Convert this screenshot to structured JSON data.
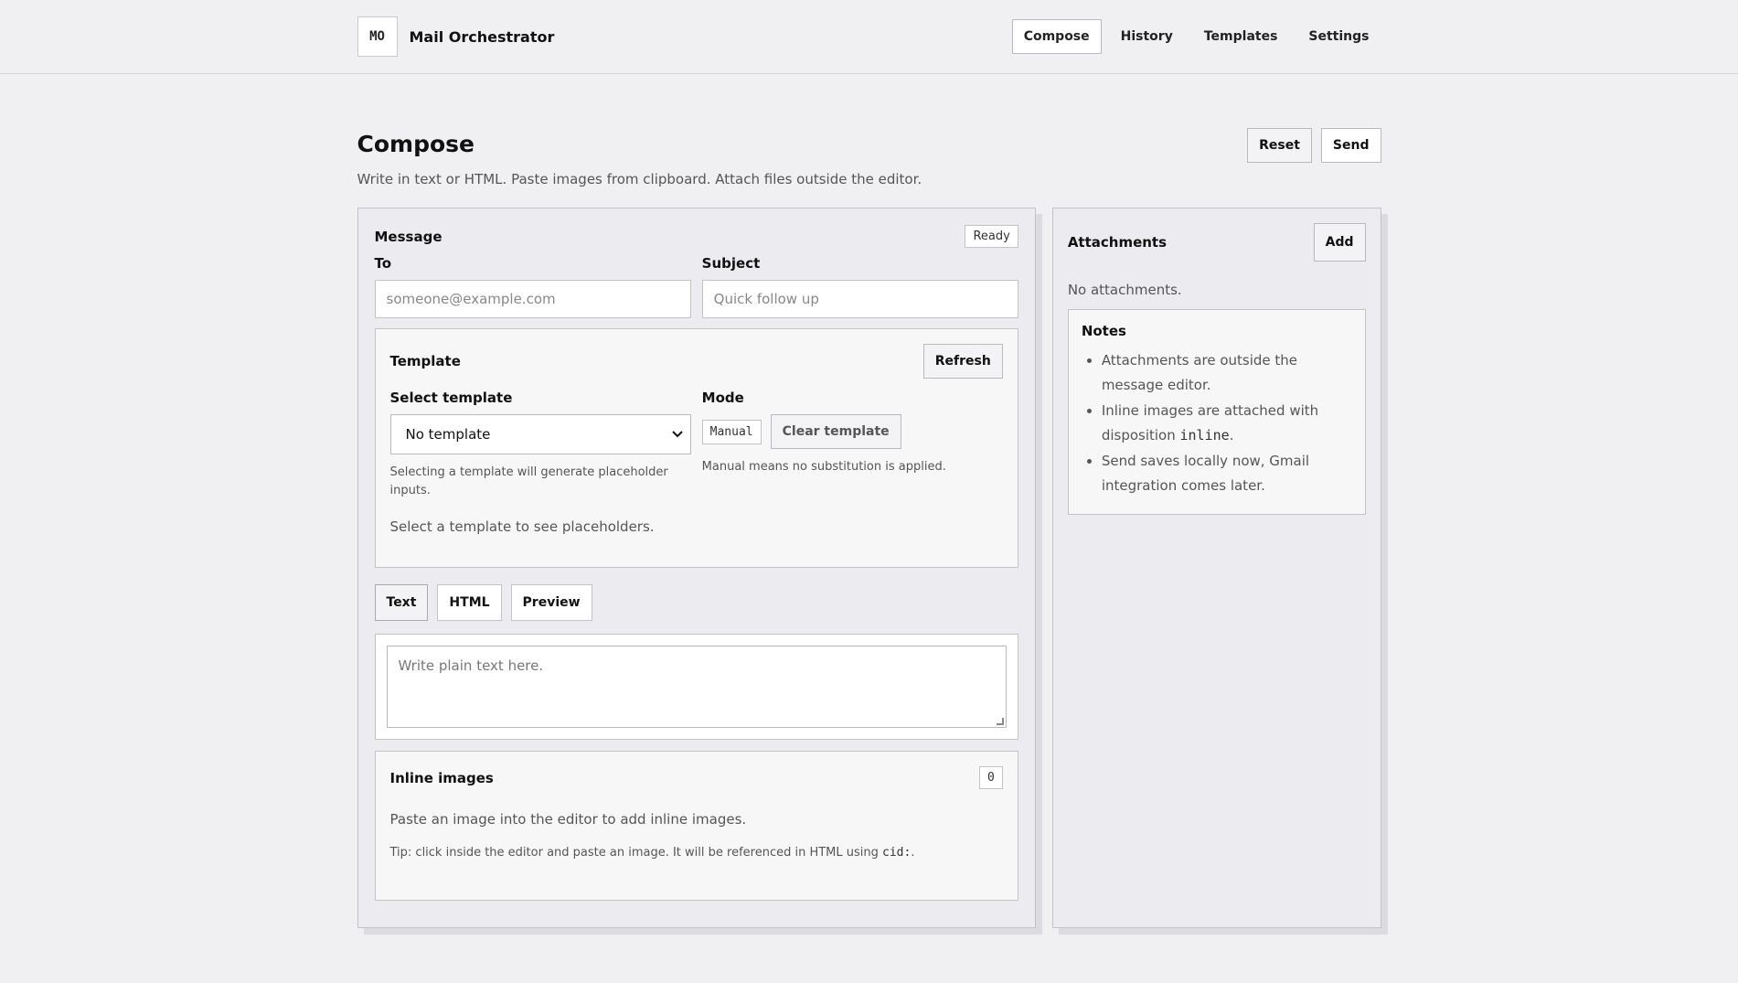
{
  "brand": {
    "logo": "MO",
    "name": "Mail Orchestrator"
  },
  "nav": [
    {
      "label": "Compose",
      "active": true
    },
    {
      "label": "History",
      "active": false
    },
    {
      "label": "Templates",
      "active": false
    },
    {
      "label": "Settings",
      "active": false
    }
  ],
  "page": {
    "title": "Compose",
    "subtitle": "Write in text or HTML. Paste images from clipboard. Attach files outside the editor.",
    "reset_label": "Reset",
    "send_label": "Send"
  },
  "message": {
    "title": "Message",
    "status": "Ready",
    "to_label": "To",
    "to_placeholder": "someone@example.com",
    "subject_label": "Subject",
    "subject_placeholder": "Quick follow up"
  },
  "template": {
    "title": "Template",
    "refresh_label": "Refresh",
    "select_label": "Select template",
    "selected": "No template",
    "select_hint": "Selecting a template will generate placeholder inputs.",
    "mode_label": "Mode",
    "mode_value": "Manual",
    "clear_label": "Clear template",
    "mode_hint": "Manual means no substitution is applied.",
    "empty": "Select a template to see placeholders."
  },
  "tabs": [
    {
      "label": "Text",
      "active": true
    },
    {
      "label": "HTML",
      "active": false
    },
    {
      "label": "Preview",
      "active": false
    }
  ],
  "editor": {
    "placeholder": "Write plain text here."
  },
  "inline_images": {
    "title": "Inline images",
    "count": "0",
    "empty": "Paste an image into the editor to add inline images.",
    "tip_prefix": "Tip: click inside the editor and paste an image. It will be referenced in HTML using ",
    "tip_code": "cid:",
    "tip_suffix": "."
  },
  "attachments": {
    "title": "Attachments",
    "add_label": "Add",
    "empty": "No attachments."
  },
  "notes": {
    "title": "Notes",
    "item1": "Attachments are outside the message editor.",
    "item2_prefix": "Inline images are attached with disposition ",
    "item2_code": "inline",
    "item2_suffix": ".",
    "item3": "Send saves locally now, Gmail integration comes later."
  }
}
